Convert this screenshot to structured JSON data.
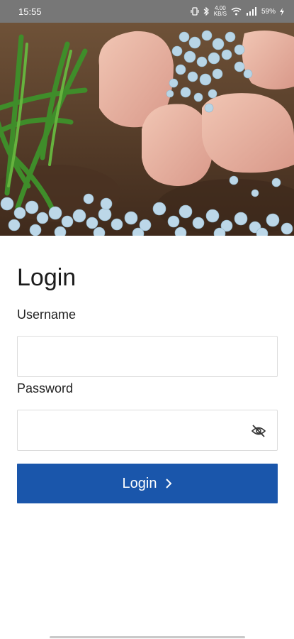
{
  "status_bar": {
    "time": "15:55",
    "net_speed_value": "4.00",
    "net_speed_unit": "KB/S",
    "battery": "59%"
  },
  "hero": {
    "image": "hand-spreading-fertilizer-granules"
  },
  "login": {
    "title": "Login",
    "username_label": "Username",
    "username_value": "",
    "password_label": "Password",
    "password_value": "",
    "button_label": "Login"
  },
  "colors": {
    "primary": "#1a56ab",
    "status_bar": "#777777",
    "input_border": "#dcdcdc"
  }
}
